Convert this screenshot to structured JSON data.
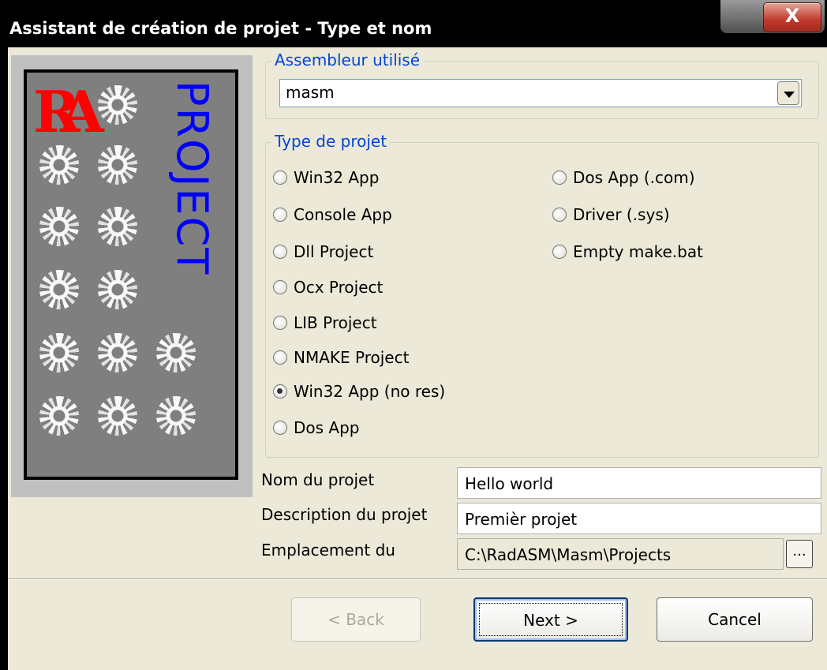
{
  "window": {
    "title": "Assistant de création de projet - Type et nom",
    "close_glyph": "X"
  },
  "image": {
    "logo_text": "RA",
    "side_text": "PROJECT"
  },
  "assembler": {
    "legend": "Assembleur utilisé",
    "selected": "masm"
  },
  "project_type": {
    "legend": "Type de projet",
    "left_options": [
      "Win32 App",
      "Console App",
      "Dll Project",
      "Ocx Project",
      "LIB Project",
      "NMAKE Project",
      "Win32 App (no res)",
      "Dos App"
    ],
    "right_options": [
      "Dos App (.com)",
      "Driver (.sys)",
      "Empty make.bat"
    ],
    "selected": "Win32 App (no res)"
  },
  "fields": {
    "name_label": "Nom du projet",
    "name_value": "Hello world",
    "desc_label": "Description du projet",
    "desc_value": "Premièr projet",
    "location_label": "Emplacement du",
    "location_value": "C:\\RadASM\\Masm\\Projects",
    "browse_label": "..."
  },
  "buttons": {
    "back": "< Back",
    "next": "Next >",
    "cancel": "Cancel"
  }
}
